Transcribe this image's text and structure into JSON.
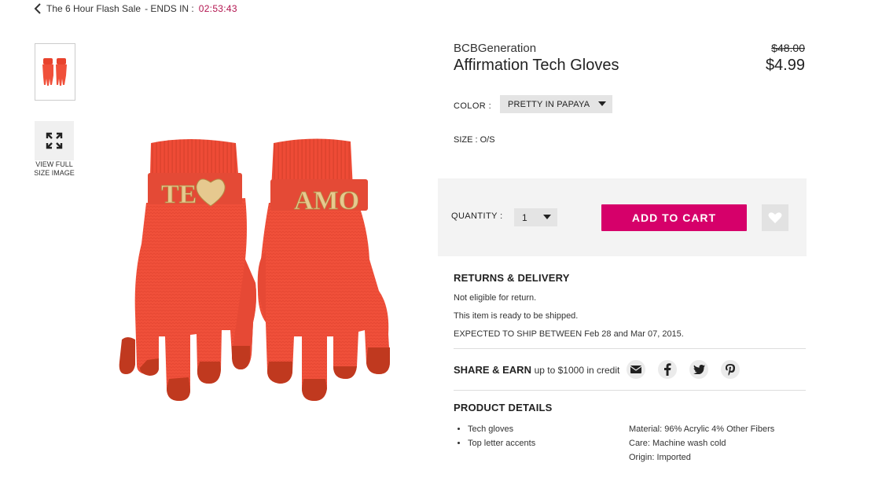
{
  "breadcrumb": {
    "sale_name": "The 6 Hour Flash Sale",
    "ends_label": "- ENDS IN :",
    "timer": "02:53:43"
  },
  "gallery": {
    "view_full_label_1": "VIEW FULL",
    "view_full_label_2": "SIZE IMAGE"
  },
  "product": {
    "brand": "BCBGeneration",
    "name": "Affirmation Tech Gloves",
    "original_price": "$48.00",
    "price": "$4.99",
    "image_text_left": "TE",
    "image_text_right": "AMO"
  },
  "options": {
    "color_label": "COLOR :",
    "color_value": "PRETTY IN PAPAYA",
    "size_label": "SIZE : O/S"
  },
  "cart": {
    "quantity_label": "QUANTITY :",
    "quantity_value": "1",
    "add_to_cart": "ADD TO CART"
  },
  "returns": {
    "title": "RETURNS & DELIVERY",
    "line1": "Not eligible for return.",
    "line2": "This item is ready to be shipped.",
    "line3": "EXPECTED TO SHIP BETWEEN Feb 28 and Mar 07, 2015."
  },
  "share": {
    "title": "SHARE & EARN",
    "subtitle": "up to $1000 in credit"
  },
  "details": {
    "title": "PRODUCT DETAILS",
    "bullets": [
      "Tech gloves",
      "Top letter accents"
    ],
    "specs": [
      "Material: 96% Acrylic 4% Other Fibers",
      "Care: Machine wash cold",
      "Origin: Imported"
    ]
  },
  "colors": {
    "accent": "#d6006a",
    "timer": "#b3144f",
    "glove": "#f0503a"
  }
}
